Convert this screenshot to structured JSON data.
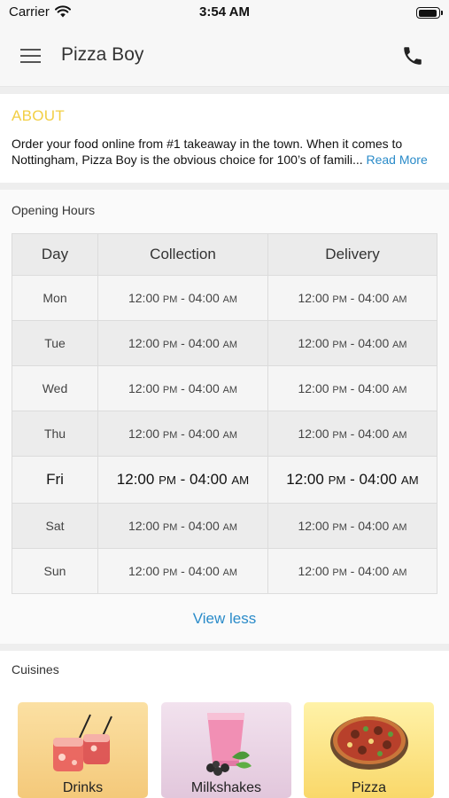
{
  "status_bar": {
    "carrier": "Carrier",
    "time": "3:54 AM"
  },
  "app_bar": {
    "title": "Pizza Boy"
  },
  "about": {
    "heading": "ABOUT",
    "text_line1": "Order your food online from #1 takeaway in the town. When it comes to",
    "text_line2": "Nottingham, Pizza Boy is the obvious choice for 100’s of famili",
    "ellipsis": "...",
    "read_more": "Read More"
  },
  "opening_hours": {
    "title": "Opening Hours",
    "headers": {
      "day": "Day",
      "collection": "Collection",
      "delivery": "Delivery"
    },
    "rows": [
      {
        "day": "Mon",
        "collection": "12:00 PM - 04:00 AM",
        "delivery": "12:00 PM - 04:00 AM"
      },
      {
        "day": "Tue",
        "collection": "12:00 PM - 04:00 AM",
        "delivery": "12:00 PM - 04:00 AM"
      },
      {
        "day": "Wed",
        "collection": "12:00 PM - 04:00 AM",
        "delivery": "12:00 PM - 04:00 AM"
      },
      {
        "day": "Thu",
        "collection": "12:00 PM - 04:00 AM",
        "delivery": "12:00 PM - 04:00 AM"
      },
      {
        "day": "Fri",
        "collection": "12:00 PM - 04:00 AM",
        "delivery": "12:00 PM - 04:00 AM"
      },
      {
        "day": "Sat",
        "collection": "12:00 PM - 04:00 AM",
        "delivery": "12:00 PM - 04:00 AM"
      },
      {
        "day": "Sun",
        "collection": "12:00 PM - 04:00 AM",
        "delivery": "12:00 PM - 04:00 AM"
      }
    ],
    "view_less": "View less"
  },
  "cuisines": {
    "title": "Cuisines",
    "items": [
      {
        "label": "Drinks",
        "icon": "cocktail-glasses-icon"
      },
      {
        "label": "Milkshakes",
        "icon": "milkshake-glass-icon"
      },
      {
        "label": "Pizza",
        "icon": "pizza-icon"
      }
    ]
  },
  "colors": {
    "accent_yellow": "#f2cf45",
    "link_blue": "#2a8bc9"
  },
  "icons": {
    "menu": "hamburger-menu-icon",
    "call": "phone-icon",
    "wifi": "wifi-icon",
    "battery": "battery-icon"
  }
}
